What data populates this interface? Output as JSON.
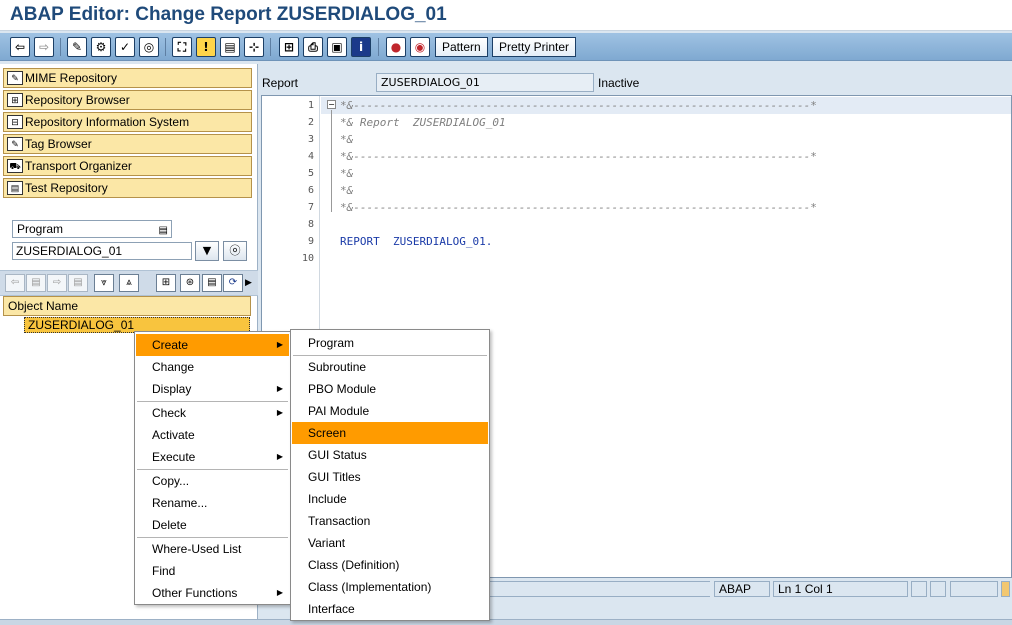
{
  "window": {
    "title": "ABAP Editor: Change Report ZUSERDIALOG_01"
  },
  "toolbar": {
    "buttons": [
      {
        "name": "back-icon",
        "glyph": "⇦"
      },
      {
        "name": "forward-icon",
        "glyph": "⇨"
      },
      {
        "name": "display-change-icon",
        "glyph": "✎"
      },
      {
        "name": "other-object-icon",
        "glyph": "⚙"
      },
      {
        "name": "check-icon",
        "glyph": "✓"
      },
      {
        "name": "activate-icon",
        "glyph": "◎"
      },
      {
        "name": "test-icon",
        "glyph": "⛶"
      },
      {
        "name": "where-used-icon",
        "glyph": "!"
      },
      {
        "name": "object-list-icon",
        "glyph": "▤"
      },
      {
        "name": "navigation-window-icon",
        "glyph": "⊹"
      },
      {
        "name": "hierarchy-icon",
        "glyph": "⊞"
      },
      {
        "name": "print-icon",
        "glyph": "⎙"
      },
      {
        "name": "layout-icon",
        "glyph": "▣"
      },
      {
        "name": "info-icon",
        "glyph": "i"
      },
      {
        "name": "breakpoint-icon",
        "glyph": "●"
      },
      {
        "name": "session-breakpoint-icon",
        "glyph": "◉"
      }
    ],
    "pattern_label": "Pattern",
    "pretty_printer_label": "Pretty Printer"
  },
  "navigator": {
    "items": [
      {
        "label": "MIME Repository",
        "icon": "✎"
      },
      {
        "label": "Repository Browser",
        "icon": "⊞"
      },
      {
        "label": "Repository Information System",
        "icon": "⊟"
      },
      {
        "label": "Tag Browser",
        "icon": "✎"
      },
      {
        "label": "Transport Organizer",
        "icon": "⛟"
      },
      {
        "label": "Test Repository",
        "icon": "▤"
      }
    ],
    "object_type": "Program",
    "object_name": "ZUSERDIALOG_01",
    "column_header": "Object Name",
    "tree_items": [
      "ZUSERDIALOG_01"
    ]
  },
  "editor": {
    "header_label": "Report",
    "program_name": "ZUSERDIALOG_01",
    "status": "Inactive",
    "lines": [
      {
        "n": "1",
        "text": "*&---------------------------------------------------------------------*",
        "kind": "comment"
      },
      {
        "n": "2",
        "text": "*& Report  ZUSERDIALOG_01",
        "kind": "comment"
      },
      {
        "n": "3",
        "text": "*&",
        "kind": "comment"
      },
      {
        "n": "4",
        "text": "*&---------------------------------------------------------------------*",
        "kind": "comment"
      },
      {
        "n": "5",
        "text": "*&",
        "kind": "comment"
      },
      {
        "n": "6",
        "text": "*&",
        "kind": "comment"
      },
      {
        "n": "7",
        "text": "*&---------------------------------------------------------------------*",
        "kind": "comment"
      },
      {
        "n": "8",
        "text": "",
        "kind": "code"
      },
      {
        "n": "9",
        "text": "REPORT  ZUSERDIALOG_01.",
        "kind": "code"
      },
      {
        "n": "10",
        "text": "",
        "kind": "code"
      }
    ]
  },
  "statusbar": {
    "language": "ABAP",
    "position": "Ln  1 Col  1"
  },
  "context_menu": {
    "items": [
      {
        "label": "Create",
        "submenu": true,
        "selected": true
      },
      {
        "label": "Change",
        "submenu": false
      },
      {
        "label": "Display",
        "submenu": true
      },
      {
        "label": "Check",
        "submenu": true
      },
      {
        "label": "Activate",
        "submenu": false
      },
      {
        "label": "Execute",
        "submenu": true
      },
      {
        "label": "Copy...",
        "submenu": false
      },
      {
        "label": "Rename...",
        "submenu": false
      },
      {
        "label": "Delete",
        "submenu": false
      },
      {
        "label": "Where-Used List",
        "submenu": false
      },
      {
        "label": "Find",
        "submenu": false
      },
      {
        "label": "Other Functions",
        "submenu": true
      }
    ]
  },
  "submenu": {
    "items": [
      {
        "label": "Program"
      },
      {
        "label": "Subroutine"
      },
      {
        "label": "PBO Module"
      },
      {
        "label": "PAI Module"
      },
      {
        "label": "Screen",
        "selected": true
      },
      {
        "label": "GUI Status"
      },
      {
        "label": "GUI Titles"
      },
      {
        "label": "Include"
      },
      {
        "label": "Transaction"
      },
      {
        "label": "Variant"
      },
      {
        "label": "Class (Definition)"
      },
      {
        "label": "Class (Implementation)"
      },
      {
        "label": "Interface"
      }
    ]
  },
  "colors": {
    "accent": "#ff9b00",
    "title": "#1f4a7a",
    "nav_button": "#fbe7a6",
    "tree_selected": "#f8c43e"
  }
}
